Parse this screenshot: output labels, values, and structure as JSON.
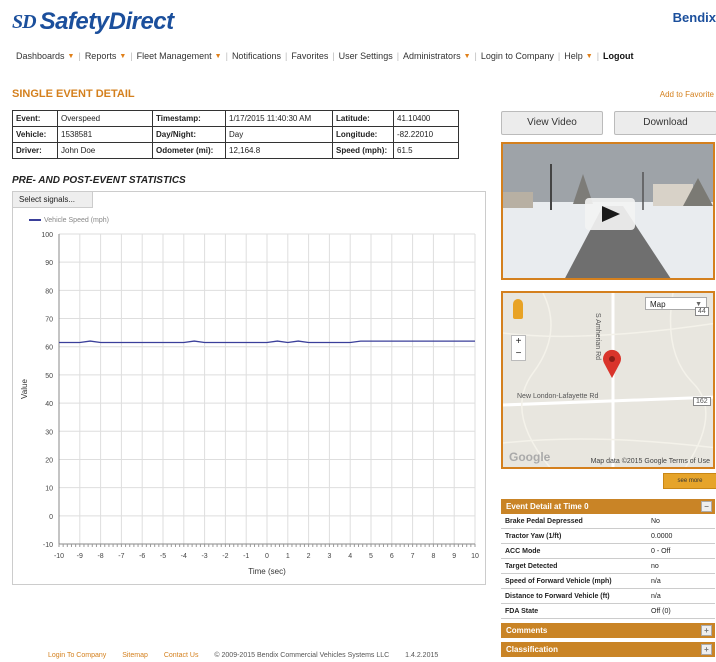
{
  "app": {
    "logo_badge": "SD",
    "logo_text": "SafetyDirect",
    "brand": "Bendix"
  },
  "nav": {
    "items": [
      {
        "label": "Dashboards",
        "dropdown": true
      },
      {
        "label": "Reports",
        "dropdown": true
      },
      {
        "label": "Fleet Management",
        "dropdown": true
      },
      {
        "label": "Notifications",
        "dropdown": false
      },
      {
        "label": "Favorites",
        "dropdown": false
      },
      {
        "label": "User Settings",
        "dropdown": false
      },
      {
        "label": "Administrators",
        "dropdown": true
      },
      {
        "label": "Login to Company",
        "dropdown": false
      },
      {
        "label": "Help",
        "dropdown": true
      },
      {
        "label": "Logout",
        "dropdown": false
      }
    ]
  },
  "page": {
    "title": "SINGLE EVENT DETAIL",
    "add_favorite": "Add to Favorite"
  },
  "info": {
    "event_label": "Event:",
    "event": "Overspeed",
    "vehicle_label": "Vehicle:",
    "vehicle": "1538581",
    "driver_label": "Driver:",
    "driver": "John Doe",
    "timestamp_label": "Timestamp:",
    "timestamp": "1/17/2015 11:40:30 AM",
    "daynight_label": "Day/Night:",
    "daynight": "Day",
    "odometer_label": "Odometer (mi):",
    "odometer": "12,164.8",
    "latitude_label": "Latitude:",
    "latitude": "41.10400",
    "longitude_label": "Longitude:",
    "longitude": "-82.22010",
    "speed_label": "Speed (mph):",
    "speed": "61.5"
  },
  "buttons": {
    "view_video": "View Video",
    "download": "Download",
    "orange": "see more"
  },
  "map": {
    "type_select": "Map",
    "road_vertical": "S Amherian Rd",
    "road_horizontal": "New London-Lafayette Rd",
    "route_badge": "162",
    "route_badge_top": "44",
    "google": "Google",
    "footer": "Map data ©2015 Google   Terms of Use",
    "zoom_in": "+",
    "zoom_out": "−"
  },
  "stats": {
    "title": "PRE- AND POST-EVENT STATISTICS",
    "select_signals": "Select signals..."
  },
  "chart_data": {
    "type": "line",
    "title": "",
    "xlabel": "Time (sec)",
    "ylabel": "Value",
    "xlim": [
      -10,
      10
    ],
    "ylim": [
      -10,
      100
    ],
    "legend_position": "top-left",
    "grid": true,
    "x_ticks": [
      -10,
      -9,
      -8,
      -7,
      -6,
      -5,
      -4,
      -3,
      -2,
      -1,
      0,
      1,
      2,
      3,
      4,
      5,
      6,
      7,
      8,
      9,
      10
    ],
    "y_ticks": [
      -10,
      0,
      10,
      20,
      30,
      40,
      50,
      60,
      70,
      80,
      90,
      100
    ],
    "series": [
      {
        "name": "Vehicle Speed (mph)",
        "color": "#3a3f9a",
        "x": [
          -10,
          -9,
          -8.5,
          -8,
          -7,
          -6,
          -5,
          -4,
          -3.5,
          -3,
          -2,
          -1,
          0,
          0.5,
          1,
          1.5,
          2,
          3,
          4,
          4.5,
          5,
          6,
          7,
          8,
          9,
          10
        ],
        "y": [
          61.5,
          61.5,
          62,
          61.5,
          61.5,
          61.5,
          61.5,
          61.5,
          62,
          61.5,
          61.5,
          61.5,
          61.5,
          62,
          61.5,
          62,
          61.5,
          61.5,
          61.5,
          62,
          62,
          62,
          62,
          62,
          62,
          62
        ]
      }
    ]
  },
  "event_detail": {
    "title": "Event Detail at Time 0",
    "toggle": "−",
    "rows": [
      {
        "label": "Brake Pedal Depressed",
        "value": "No"
      },
      {
        "label": "Tractor Yaw (1/ft)",
        "value": "0.0000"
      },
      {
        "label": "ACC Mode",
        "value": "0 - Off"
      },
      {
        "label": "Target Detected",
        "value": "no"
      },
      {
        "label": "Speed of Forward Vehicle (mph)",
        "value": "n/a"
      },
      {
        "label": "Distance to Forward Vehicle (ft)",
        "value": "n/a"
      },
      {
        "label": "FDA State",
        "value": "Off (0)"
      }
    ]
  },
  "comments": {
    "title": "Comments",
    "toggle": "+"
  },
  "classification": {
    "title": "Classification",
    "toggle": "+"
  },
  "footer": {
    "login": "Login To Company",
    "sitemap": "Sitemap",
    "contact": "Contact Us",
    "copyright": "© 2009-2015 Bendix Commercial Vehicles Systems LLC",
    "version": "1.4.2.2015"
  }
}
